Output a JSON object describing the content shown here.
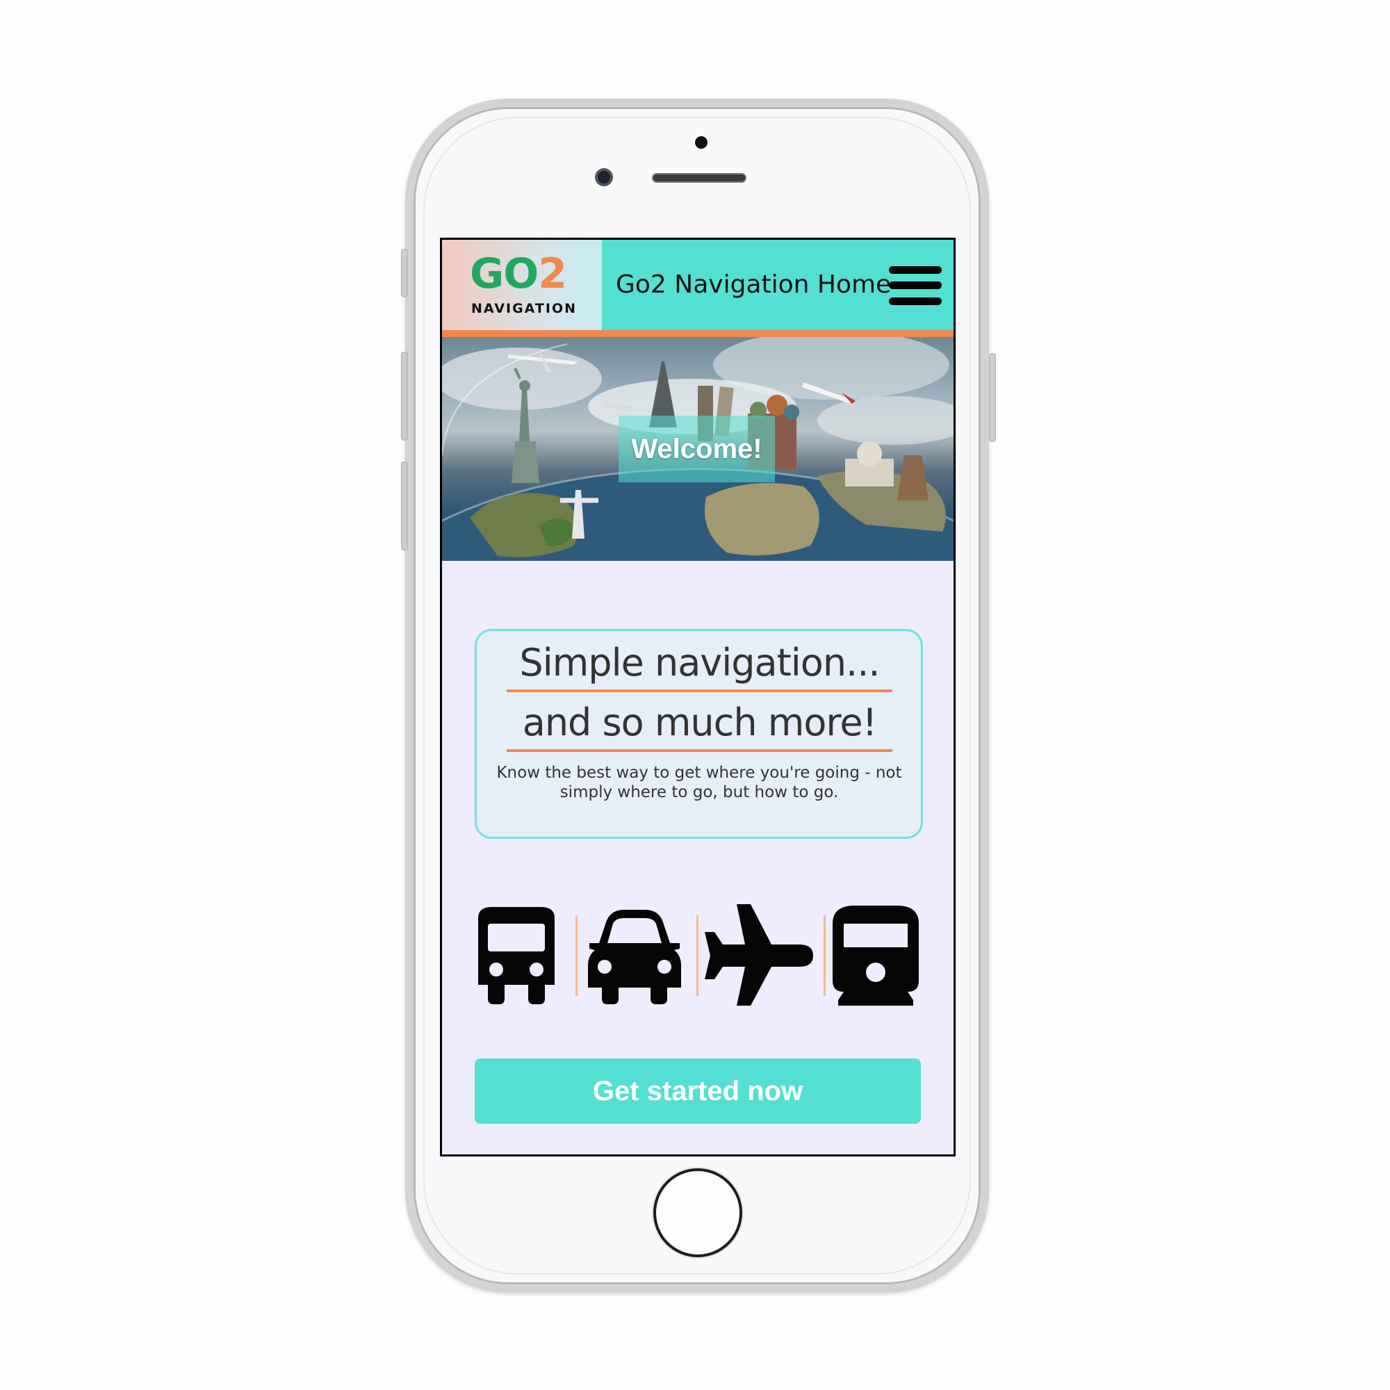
{
  "header": {
    "logo_main_go": "GO",
    "logo_main_two": "2",
    "logo_sub": "NAVIGATION",
    "title": "Go2 Navigation Home",
    "menu_icon": "hamburger-menu-icon"
  },
  "hero": {
    "welcome": "Welcome!"
  },
  "tagline": {
    "line1": "Simple navigation...",
    "line2": "and so much more!",
    "description": "Know the best way to get where you're going - not simply where to go, but how to go."
  },
  "modes": [
    {
      "icon": "bus-icon"
    },
    {
      "icon": "car-icon"
    },
    {
      "icon": "airplane-icon"
    },
    {
      "icon": "train-icon"
    }
  ],
  "cta": {
    "label": "Get started now"
  },
  "colors": {
    "accent": "#53e0d2",
    "orange": "#f3884f",
    "logo_green": "#22a760",
    "page_bg": "#efecfe"
  }
}
